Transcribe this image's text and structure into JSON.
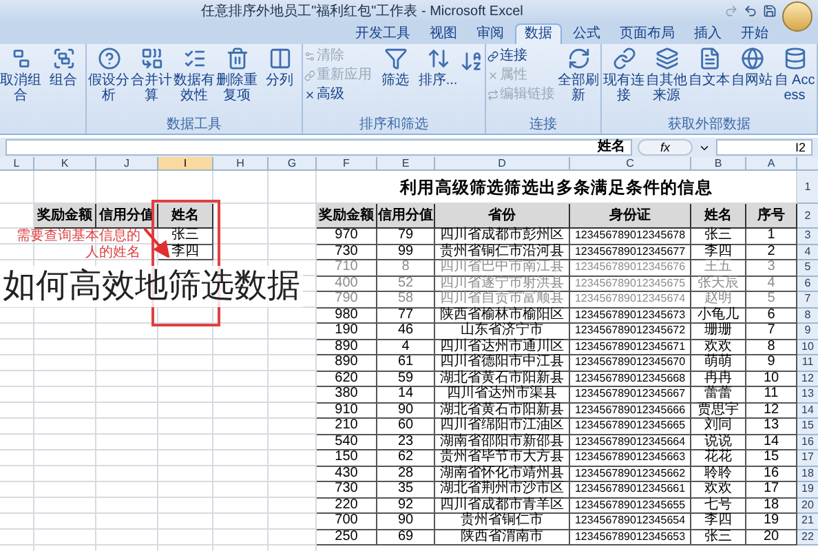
{
  "window": {
    "title": "任意排序外地员工\"福利红包\"工作表 - Microsoft Excel"
  },
  "tabs": [
    {
      "label": "开发工具",
      "selected": false
    },
    {
      "label": "视图",
      "selected": false
    },
    {
      "label": "审阅",
      "selected": false
    },
    {
      "label": "数据",
      "selected": true
    },
    {
      "label": "公式",
      "selected": false
    },
    {
      "label": "页面布局",
      "selected": false
    },
    {
      "label": "插入",
      "selected": false
    },
    {
      "label": "开始",
      "selected": false
    }
  ],
  "ribbon": [
    {
      "buttons": [
        {
          "kind": "ungroup",
          "label": "取消组合"
        },
        {
          "kind": "group",
          "label": "组合"
        }
      ]
    },
    {
      "label": "数据工具",
      "buttons": [
        {
          "kind": "whatif",
          "label": "假设分析"
        },
        {
          "kind": "merge",
          "label": "合并计算"
        },
        {
          "kind": "validate",
          "label": "数据有效性"
        },
        {
          "kind": "dedupe",
          "label": "删除重复项"
        },
        {
          "kind": "split",
          "label": "分列"
        }
      ]
    },
    {
      "label": "排序和筛选",
      "small": [
        {
          "label": "清除",
          "disabled": true
        },
        {
          "label": "重新应用",
          "disabled": true
        },
        {
          "label": "高级",
          "disabled": false
        }
      ],
      "buttons": [
        {
          "kind": "filter",
          "label": "筛选"
        },
        {
          "kind": "sort",
          "label": "排序..."
        },
        {
          "kind": "sortaz"
        }
      ]
    },
    {
      "label": "连接",
      "small": [
        {
          "label": "连接",
          "disabled": false
        },
        {
          "label": "属性",
          "disabled": true
        },
        {
          "label": "编辑链接",
          "disabled": true
        }
      ],
      "buttons": [
        {
          "kind": "refresh",
          "label": "全部刷新"
        }
      ]
    },
    {
      "label": "获取外部数据",
      "buttons": [
        {
          "kind": "connection",
          "label": "现有连接"
        },
        {
          "kind": "other",
          "label": "自其他来源"
        },
        {
          "kind": "text",
          "label": "自文本"
        },
        {
          "kind": "web",
          "label": "自网站"
        },
        {
          "kind": "access",
          "label": "自 Access"
        }
      ]
    }
  ],
  "formula_bar": {
    "content": "姓名",
    "fx": "fx",
    "name_box": "I2"
  },
  "columns": [
    {
      "letter": "L",
      "selected": false
    },
    {
      "letter": "K",
      "selected": false
    },
    {
      "letter": "J",
      "selected": false
    },
    {
      "letter": "I",
      "selected": true
    },
    {
      "letter": "H",
      "selected": false
    },
    {
      "letter": "G",
      "selected": false
    },
    {
      "letter": "F",
      "selected": false
    },
    {
      "letter": "E",
      "selected": false
    },
    {
      "letter": "D",
      "selected": false
    },
    {
      "letter": "C",
      "selected": false
    },
    {
      "letter": "B",
      "selected": false
    },
    {
      "letter": "A",
      "selected": false
    }
  ],
  "row_numbers": [
    "1",
    "2",
    "3",
    "4",
    "5",
    "6",
    "7",
    "8",
    "9",
    "10",
    "11",
    "12",
    "13",
    "14",
    "15",
    "16",
    "17",
    "18",
    "19",
    "20",
    "21",
    "22"
  ],
  "sheet": {
    "title": "利用高级筛选筛选出多条满足条件的信息",
    "headers": [
      "奖励金额",
      "信用分值",
      "省份",
      "身份证",
      "姓名",
      "序号"
    ],
    "rows": [
      {
        "cells": [
          "970",
          "79",
          "四川省成都市彭州区",
          "123456789012345678",
          "张三",
          "1"
        ],
        "dimmed": false
      },
      {
        "cells": [
          "730",
          "99",
          "贵州省铜仁市沿河县",
          "123456789012345677",
          "李四",
          "2"
        ],
        "dimmed": false
      },
      {
        "cells": [
          "710",
          "8",
          "四川省巴中市南江县",
          "123456789012345676",
          "王五",
          "3"
        ],
        "dimmed": true
      },
      {
        "cells": [
          "400",
          "52",
          "四川省遂宁市射洪县",
          "123456789012345675",
          "张天辰",
          "4"
        ],
        "dimmed": true
      },
      {
        "cells": [
          "790",
          "58",
          "四川省自贡市富顺县",
          "123456789012345674",
          "赵明",
          "5"
        ],
        "dimmed": true
      },
      {
        "cells": [
          "980",
          "77",
          "陕西省榆林市榆阳区",
          "123456789012345673",
          "小龟儿",
          "6"
        ],
        "dimmed": false
      },
      {
        "cells": [
          "190",
          "46",
          "山东省济宁市",
          "123456789012345672",
          "珊珊",
          "7"
        ],
        "dimmed": false
      },
      {
        "cells": [
          "890",
          "4",
          "四川省达州市通川区",
          "123456789012345671",
          "欢欢",
          "8"
        ],
        "dimmed": false
      },
      {
        "cells": [
          "890",
          "61",
          "四川省德阳市中江县",
          "123456789012345670",
          "萌萌",
          "9"
        ],
        "dimmed": false
      },
      {
        "cells": [
          "620",
          "59",
          "湖北省黄石市阳新县",
          "123456789012345668",
          "冉冉",
          "10"
        ],
        "dimmed": false
      },
      {
        "cells": [
          "380",
          "14",
          "四川省达州市渠县",
          "123456789012345667",
          "蕾蕾",
          "11"
        ],
        "dimmed": false
      },
      {
        "cells": [
          "910",
          "90",
          "湖北省黄石市阳新县",
          "123456789012345666",
          "贾思宇",
          "12"
        ],
        "dimmed": false
      },
      {
        "cells": [
          "210",
          "60",
          "四川省绵阳市江油区",
          "123456789012345665",
          "刘同",
          "13"
        ],
        "dimmed": false
      },
      {
        "cells": [
          "540",
          "23",
          "湖南省邵阳市新邵县",
          "123456789012345664",
          "说说",
          "14"
        ],
        "dimmed": false
      },
      {
        "cells": [
          "150",
          "62",
          "贵州省毕节市大方县",
          "123456789012345663",
          "花花",
          "15"
        ],
        "dimmed": false
      },
      {
        "cells": [
          "430",
          "28",
          "湖南省怀化市靖州县",
          "123456789012345662",
          "聆聆",
          "16"
        ],
        "dimmed": false
      },
      {
        "cells": [
          "730",
          "35",
          "湖北省荆州市沙市区",
          "123456789012345661",
          "欢欢",
          "17"
        ],
        "dimmed": false
      },
      {
        "cells": [
          "220",
          "92",
          "四川省成都市青羊区",
          "123456789012345655",
          "七号",
          "18"
        ],
        "dimmed": false
      },
      {
        "cells": [
          "700",
          "90",
          "贵州省铜仁市",
          "123456789012345654",
          "李四",
          "19"
        ],
        "dimmed": false
      },
      {
        "cells": [
          "250",
          "69",
          "陕西省渭南市",
          "123456789012345653",
          "张三",
          "20"
        ],
        "dimmed": false
      }
    ]
  },
  "criteria": {
    "headers": [
      "奖励金额",
      "信用分值",
      "姓名"
    ],
    "names": [
      "张三",
      "李四"
    ]
  },
  "annotation": {
    "lines": [
      "需要查询基本信息的",
      "人的姓名"
    ]
  },
  "caption": "如何高效地筛选数据"
}
